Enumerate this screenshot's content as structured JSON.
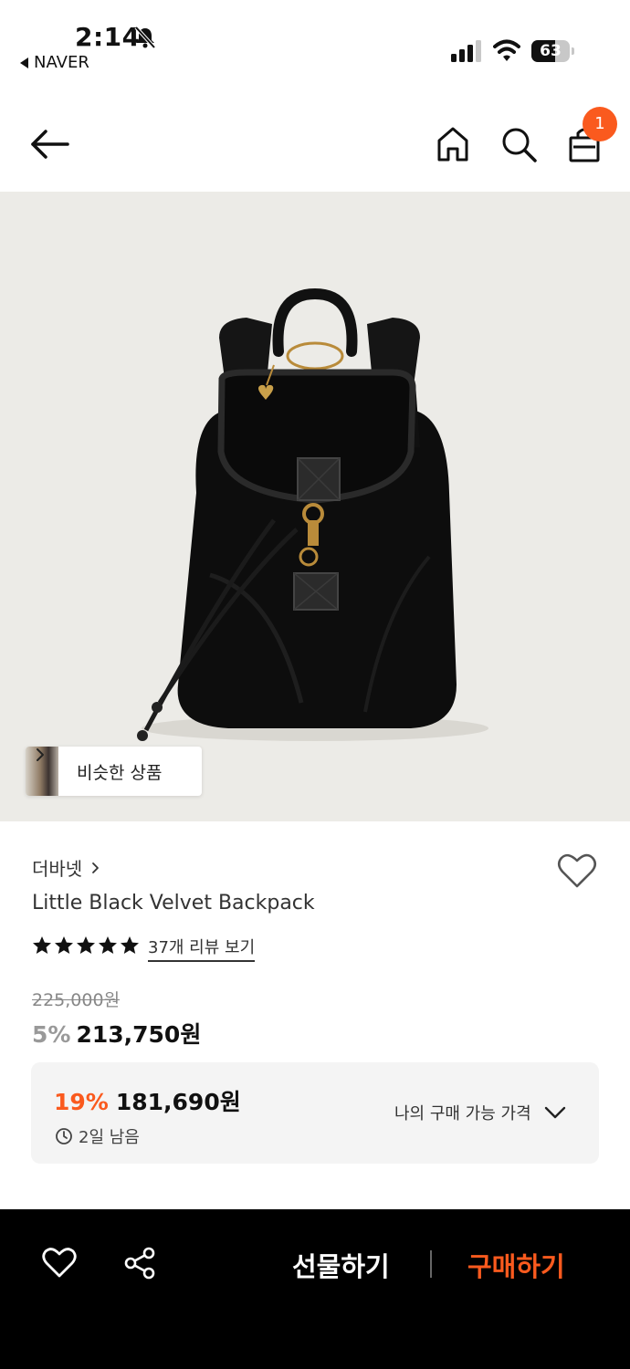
{
  "status_bar": {
    "time": "2:14",
    "back_app": "NAVER",
    "battery": "63",
    "battery_level": 0.63
  },
  "nav": {
    "cart_count": "1",
    "icons": [
      "back-arrow-icon",
      "home-icon",
      "search-icon",
      "shopping-bag-icon"
    ]
  },
  "image": {
    "similar_label": "비슷한 상품"
  },
  "product": {
    "brand": "더바넷",
    "title": "Little Black Velvet Backpack",
    "rating": 5,
    "review_link": "37개 리뷰 보기",
    "original_price": "225,000원",
    "discount_rate": "5%",
    "discount_price": "213,750원"
  },
  "best_price": {
    "rate": "19%",
    "price": "181,690원",
    "remaining": "2일 남음",
    "my_price_label": "나의 구매 가능 가격"
  },
  "bottom_bar": {
    "gift_label": "선물하기",
    "buy_label": "구매하기"
  },
  "colors": {
    "accent": "#fa5a1e",
    "image_bg": "#ecebe7",
    "bottom_bar": "#000000"
  }
}
